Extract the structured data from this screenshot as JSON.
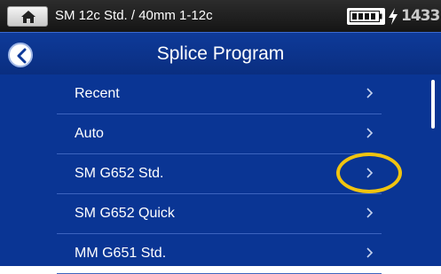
{
  "statusbar": {
    "program_name": "SM 12c Std. / 40mm 1-12c",
    "time": "1433",
    "icons": [
      "home-icon",
      "battery-icon",
      "charging-bolt-icon"
    ]
  },
  "header": {
    "title": "Splice Program",
    "back_icon": "back-arrow-icon"
  },
  "list": {
    "items": [
      {
        "label": "Recent"
      },
      {
        "label": "Auto"
      },
      {
        "label": "SM G652 Std."
      },
      {
        "label": "SM G652 Quick"
      },
      {
        "label": "MM G651 Std."
      }
    ]
  },
  "colors": {
    "header_bg": "#0e3a99",
    "list_bg": "#0a3594",
    "highlight": "#f1c40f"
  }
}
